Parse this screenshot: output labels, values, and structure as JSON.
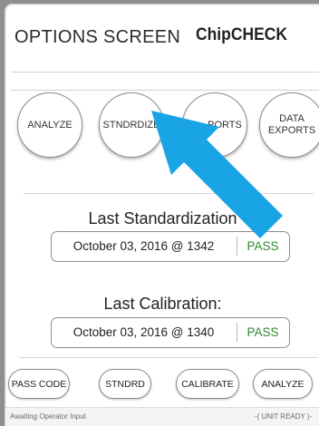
{
  "header": {
    "title": "OPTIONS SCREEN",
    "brand": "ChipCHECK"
  },
  "top_buttons": [
    {
      "label": "ANALYZE"
    },
    {
      "label": "STNDRDIZE"
    },
    {
      "label": "PORTS"
    },
    {
      "label": "DATA\nEXPORTS"
    }
  ],
  "standardization": {
    "title": "Last Standardization",
    "date": "October 03, 2016 @ 1342",
    "status": "PASS"
  },
  "calibration": {
    "title": "Last Calibration:",
    "date": "October 03, 2016 @ 1340",
    "status": "PASS"
  },
  "bottom_buttons": [
    {
      "label": "PASS CODE"
    },
    {
      "label": "STNDRD"
    },
    {
      "label": "CALIBRATE"
    },
    {
      "label": "ANALYZE"
    }
  ],
  "status_bar": {
    "message": "Awaiting Operator Input",
    "unit_status": "-( UNIT READY )-"
  },
  "colors": {
    "pass": "#2e8a2e",
    "arrow": "#19a4e6"
  }
}
